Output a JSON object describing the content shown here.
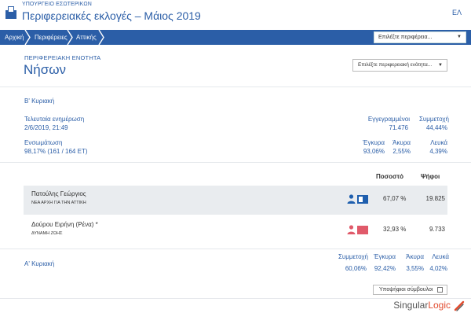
{
  "header": {
    "ministry": "ΥΠΟΥΡΓΕΙΟ ΕΣΩΤΕΡΙΚΩΝ",
    "title": "Περιφερειακές εκλογές – Μάιος 2019",
    "lang": "ΕΛ"
  },
  "nav": {
    "breadcrumbs": [
      "Αρχική",
      "Περιφέρειες",
      "Αττικής"
    ],
    "region_select": "Επιλέξτε περιφέρεια..."
  },
  "region": {
    "kicker": "ΠΕΡΙΦΕΡΕΙΑΚΗ ΕΝΟΤΗΤΑ",
    "name": "Νήσων",
    "unit_select": "Επιλέξτε περιφερειακή ενότητα..."
  },
  "round_b": {
    "label": "Β' Κυριακή",
    "last_update_label": "Τελευταία ενημέρωση",
    "last_update_value": "2/6/2019, 21:49",
    "integration_label": "Ενσωμάτωση",
    "integration_value": "98,17% (161 / 164 ΕΤ)",
    "registered_label": "Εγγεγραμμένοι",
    "registered_value": "71.476",
    "turnout_label": "Συμμετοχή",
    "turnout_value": "44,44%",
    "valid_label": "Έγκυρα",
    "valid_value": "93,06%",
    "invalid_label": "Άκυρα",
    "invalid_value": "2,55%",
    "blank_label": "Λευκά",
    "blank_value": "4,39%"
  },
  "table": {
    "col_percent": "Ποσοστό",
    "col_votes": "Ψήφοι",
    "rows": [
      {
        "name": "Πατούλης Γεώργιος",
        "party": "ΝΕΑ ΑΡΧΗ ΓΙΑ ΤΗΝ ΑΤΤΙΚΗ",
        "percent": "67,07 %",
        "votes": "19.825",
        "color": "#1f5fae"
      },
      {
        "name": "Δούρου Ειρήνη (Ρένα) *",
        "party": "ΔΥΝΑΜΗ ΖΩΗΣ",
        "percent": "32,93 %",
        "votes": "9.733",
        "color": "#e05a6a"
      }
    ]
  },
  "round_a": {
    "label": "Α' Κυριακή",
    "turnout_label": "Συμμετοχή",
    "turnout_value": "60,06%",
    "valid_label": "Έγκυρα",
    "valid_value": "92,42%",
    "invalid_label": "Άκυρα",
    "invalid_value": "3,55%",
    "blank_label": "Λευκά",
    "blank_value": "4,02%"
  },
  "councillors_label": "Υποψήφιοι σύμβουλοι",
  "brand": {
    "part1": "Singular",
    "part2": "Logic"
  },
  "icons": {
    "logo": "ballot-box-icon",
    "select_caret": "caret-down-icon",
    "breadcrumb_separator": "chevron-right-icon",
    "candidate": "person-icon",
    "brand_mark": "singular-logic-mark-icon"
  },
  "colors": {
    "primary": "#2b5ea7",
    "brand_accent": "#e24a2d",
    "row_shade": "#e9ecef"
  }
}
